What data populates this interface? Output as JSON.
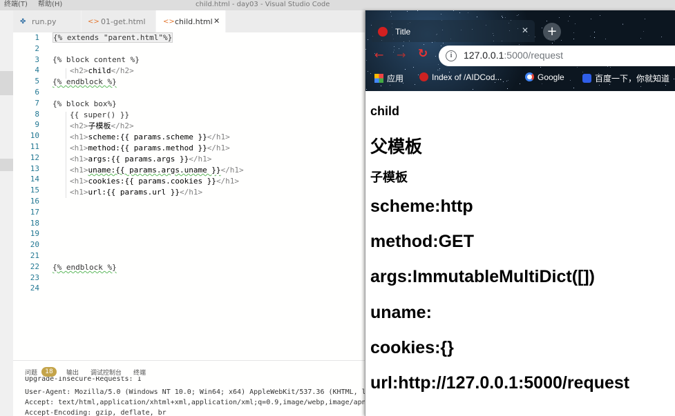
{
  "vscode": {
    "menu": [
      "终端(T)",
      "帮助(H)"
    ],
    "window_title": "child.html - day03 - Visual Studio Code",
    "tabs": [
      {
        "label": "run.py",
        "icon": "python-icon"
      },
      {
        "label": "01-get.html",
        "icon": "html-icon"
      },
      {
        "label": "child.html",
        "icon": "html-icon",
        "active": true
      }
    ],
    "line_numbers": [
      "1",
      "2",
      "3",
      "4",
      "5",
      "6",
      "7",
      "8",
      "9",
      "10",
      "11",
      "12",
      "13",
      "14",
      "15",
      "16",
      "17",
      "18",
      "19",
      "20",
      "21",
      "22",
      "23",
      "24"
    ],
    "code": {
      "l1": "{% extends \"parent.html\"%}",
      "l3": "{% block content %}",
      "l4_tag_open": "<h2>",
      "l4_text": "child",
      "l4_tag_close": "</h2>",
      "l5": "{% endblock %}",
      "l7": "{% block box%}",
      "l8": "{{ super() }}",
      "l9_text": "子模板",
      "l10_text": "scheme:{{ params.scheme }}",
      "l11_text": "method:{{ params.method }}",
      "l12_text": "args:{{ params.args }}",
      "l13_text": "uname:{{ params.args.uname }}",
      "l14_text": "cookies:{{ params.cookies }}",
      "l15_text": "url:{{ params.url }}",
      "l22": "{% endblock %}"
    },
    "panel": {
      "tabs": [
        "问题",
        "输出",
        "调试控制台",
        "终端"
      ],
      "problem_count": "18",
      "terminal_lines": [
        "Upgrade-Insecure-Requests: 1",
        "User-Agent: Mozilla/5.0 (Windows NT 10.0; Win64; x64) AppleWebKit/537.36 (KHTML, l",
        "Accept: text/html,application/xhtml+xml,application/xml;q=0.9,image/webp,image/apn",
        "Accept-Encoding: gzip, deflate, br"
      ]
    }
  },
  "chrome": {
    "tab_title": "Title",
    "url_host": "127.0.0.1",
    "url_rest": ":5000/request",
    "bookmarks": [
      "应用",
      "Index of /AIDCod...",
      "Google",
      "百度一下，你就知道"
    ],
    "page": {
      "h2_child": "child",
      "h1_parent": "父模板",
      "h2_child_tpl": "子模板",
      "scheme": "scheme:http",
      "method": "method:GET",
      "args": "args:ImmutableMultiDict([])",
      "uname": "uname:",
      "cookies": "cookies:{}",
      "url": "url:http://127.0.0.1:5000/request"
    }
  }
}
